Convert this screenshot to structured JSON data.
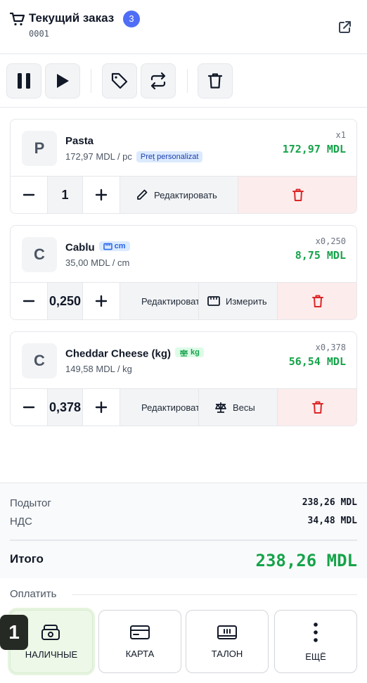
{
  "header": {
    "title": "Текущий заказ",
    "count": "3",
    "order_number": "0001",
    "icons": {
      "cart": "cart-icon",
      "external": "external-link-icon"
    }
  },
  "toolbar": {
    "buttons": [
      "pause-icon",
      "play-icon",
      "tag-icon",
      "swap-icon",
      "trash-icon"
    ]
  },
  "items": [
    {
      "initial": "P",
      "name": "Pasta",
      "unit_price": "172,97 MDL / pc",
      "tag": "Preț personalizat",
      "qty_label": "x1",
      "total": "172,97 MDL",
      "qty": "1",
      "edit_label": "Редактировать"
    },
    {
      "initial": "C",
      "name": "Cablu",
      "unit_badge": "cm",
      "unit_price": "35,00 MDL / cm",
      "qty_label": "x0,250",
      "total": "8,75 MDL",
      "qty": "0,250",
      "edit_label": "Редактировать",
      "extra_label": "Измерить"
    },
    {
      "initial": "C",
      "name": "Cheddar Cheese (kg)",
      "unit_badge": "kg",
      "unit_price": "149,58 MDL / kg",
      "qty_label": "x0,378",
      "total": "56,54 MDL",
      "qty": "0,378",
      "edit_label": "Редактировать",
      "extra_label": "Весы"
    }
  ],
  "summary": {
    "subtotal_label": "Подытог",
    "subtotal": "238,26 MDL",
    "vat_label": "НДС",
    "vat": "34,48 MDL",
    "total_label": "Итого",
    "total": "238,26 MDL"
  },
  "pay": {
    "label": "Оплатить",
    "hotkey": "1",
    "buttons": [
      {
        "label": "НАЛИЧНЫЕ",
        "icon": "cash-icon"
      },
      {
        "label": "КАРТА",
        "icon": "card-icon"
      },
      {
        "label": "ТАЛОН",
        "icon": "ticket-icon"
      },
      {
        "label": "ЕЩЁ",
        "icon": "more-icon"
      }
    ]
  },
  "colors": {
    "accent": "#4f6df5",
    "price_green": "#16a34a",
    "delete_red": "#dc2626",
    "delete_bg": "#fdecec",
    "tag_blue_bg": "#dbeafe",
    "active_pay_bg": "#eef8e8"
  }
}
